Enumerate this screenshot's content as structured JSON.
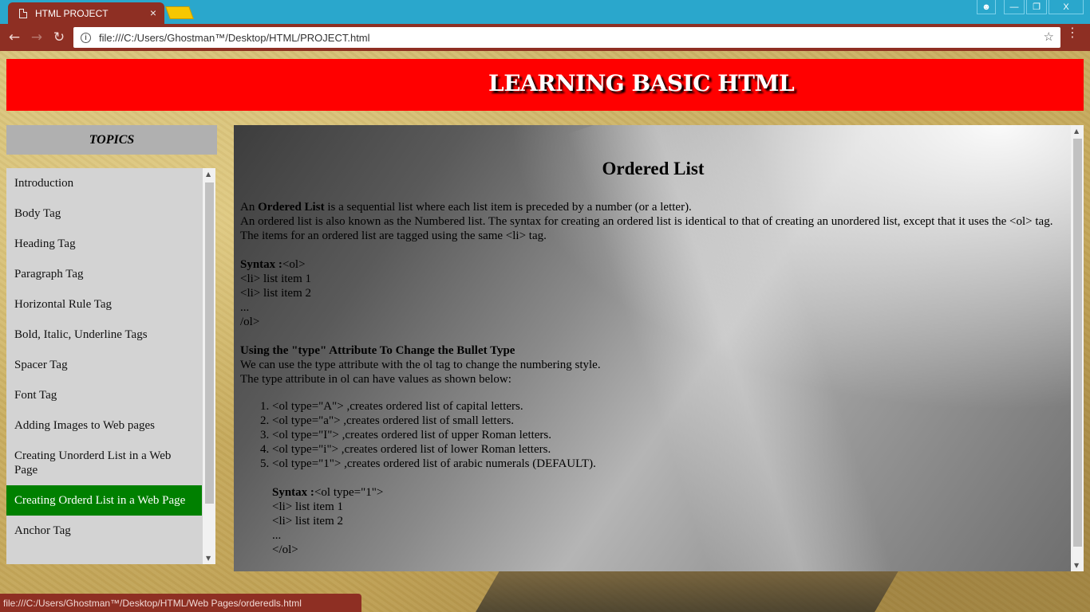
{
  "browser": {
    "tab_title": "HTML PROJECT",
    "tab_close": "×",
    "url": "file:///C:/Users/Ghostman™/Desktop/HTML/PROJECT.html",
    "status_url": "file:///C:/Users/Ghostman™/Desktop/HTML/Web Pages/orderedls.html",
    "win_minimize": "—",
    "win_maximize": "❐",
    "win_close": "X",
    "icons": [
      "page-icon",
      "back-arrow-icon",
      "forward-arrow-icon",
      "reload-icon",
      "info-icon",
      "star-icon",
      "menu-icon",
      "user-icon"
    ]
  },
  "banner": {
    "title": "LEARNING BASIC HTML"
  },
  "sidebar": {
    "header": "TOPICS",
    "items": [
      {
        "label": "Introduction"
      },
      {
        "label": "Body Tag"
      },
      {
        "label": "Heading Tag"
      },
      {
        "label": "Paragraph Tag"
      },
      {
        "label": "Horizontal Rule Tag"
      },
      {
        "label": "Bold, Italic, Underline Tags"
      },
      {
        "label": "Spacer Tag"
      },
      {
        "label": "Font Tag"
      },
      {
        "label": "Adding Images to Web pages"
      },
      {
        "label": "Creating Unorderd List in a Web Page"
      },
      {
        "label": "Creating Orderd List in a Web Page"
      },
      {
        "label": "Anchor Tag"
      }
    ],
    "active_index": 10
  },
  "article": {
    "heading": "Ordered List",
    "intro_prefix": "An ",
    "intro_bold": "Ordered List",
    "intro_rest": " is a sequential list where each list item is preceded by a number (or a letter).",
    "intro_line2": "An ordered list is also known as the Numbered list. The syntax for creating an ordered list is identical to that of creating an unordered list, except that it uses the <ol> tag. The items for an ordered list are tagged using the same <li> tag.",
    "syntax_label": "Syntax :",
    "syntax_lines": [
      "<ol>",
      "<li> list item 1",
      "<li> list item 2",
      "...",
      "/ol>"
    ],
    "type_heading": "Using the \"type\" Attribute To Change the Bullet Type",
    "type_line1": "We can use the type attribute with the ol tag to change the numbering style.",
    "type_line2": "The type attribute in ol can have values as shown below:",
    "type_items": [
      "<ol type=\"A\"> ,creates ordered list of capital letters.",
      "<ol type=\"a\"> ,creates ordered list of small letters.",
      "<ol type=\"I\"> ,creates ordered list of upper Roman letters.",
      "<ol type=\"i\"> ,creates ordered list of lower Roman letters.",
      "<ol type=\"1\"> ,creates ordered list of arabic numerals (DEFAULT)."
    ],
    "syntax2_label": "Syntax :",
    "syntax2_lines": [
      "<ol type=\"1\">",
      "<li> list item 1",
      "<li> list item 2",
      "...",
      "</ol>"
    ]
  }
}
